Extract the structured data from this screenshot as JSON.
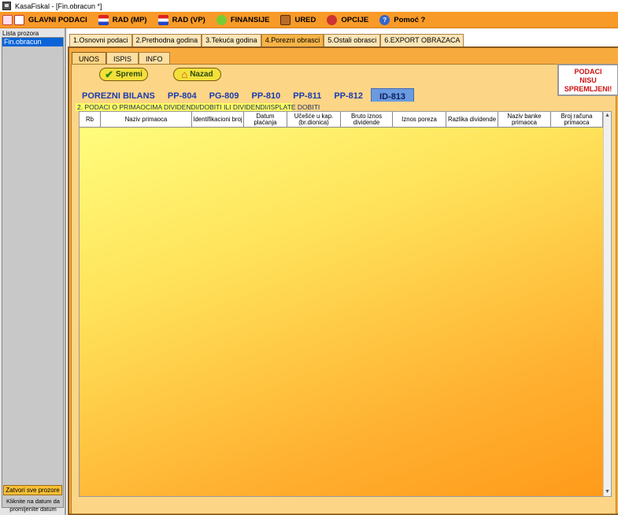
{
  "window": {
    "title": "KasaFiskal  - [Fin.obracun *]"
  },
  "menu": [
    {
      "label": "GLAVNI PODACI",
      "icon": "document-icon",
      "name": "menu-glavni-podaci"
    },
    {
      "label": "RAD (MP)",
      "icon": "flag-icon",
      "name": "menu-rad-mp"
    },
    {
      "label": "RAD (VP)",
      "icon": "flag-icon",
      "name": "menu-rad-vp"
    },
    {
      "label": "FINANSIJE",
      "icon": "finance-icon",
      "name": "menu-finansije"
    },
    {
      "label": "URED",
      "icon": "briefcase-icon",
      "name": "menu-ured"
    },
    {
      "label": "OPCIJE",
      "icon": "options-icon",
      "name": "menu-opcije"
    },
    {
      "label": "Pomoć ?",
      "icon": "help-icon",
      "name": "menu-pomoc"
    }
  ],
  "sidebar": {
    "header": "Lista prozora",
    "items": [
      "Fin.obracun"
    ],
    "close_all": "Zatvori sve prozore",
    "hint": "Kliknite na datum da promijenite datum"
  },
  "main_tabs": [
    "1.Osnovni podaci",
    "2.Prethodna godina",
    "3.Tekuća godina",
    "4.Porezni obrasci",
    "5.Ostali obrasci",
    "6.EXPORT OBRAZACA"
  ],
  "main_tab_active": 3,
  "sub_tabs": [
    "UNOS",
    "ISPIS",
    "INFO"
  ],
  "sub_tab_active": 0,
  "buttons": {
    "save": "Spremi",
    "back": "Nazad"
  },
  "status": {
    "line1": "PODACI",
    "line2": "NISU",
    "line3": "SPREMLJENI!"
  },
  "form_tabs": [
    "POREZNI BILANS",
    "PP-804",
    "PG-809",
    "PP-810",
    "PP-811",
    "PP-812",
    "ID-813"
  ],
  "form_tab_active": 6,
  "section_title": "2. PODACI O PRIMAOCIMA DIVIDENDI/DOBITI ILI DIVIDENDI/ISPLATE DOBITI",
  "columns": [
    "Rb",
    "Naziv primaoca",
    "Identifikacioni broj",
    "Datum plaćanja",
    "Učešće u kap.(br.dionica)",
    "Bruto iznos dividende",
    "Iznos poreza",
    "Razlika dividende",
    "Naziv banke primaoca",
    "Broj računa primaoca"
  ],
  "rows": [],
  "colors": {
    "menu_bg": "#f89a28",
    "accent": "#f7ab3f",
    "active_form_tab": "#6a9ae0",
    "status_text": "#d01010"
  }
}
